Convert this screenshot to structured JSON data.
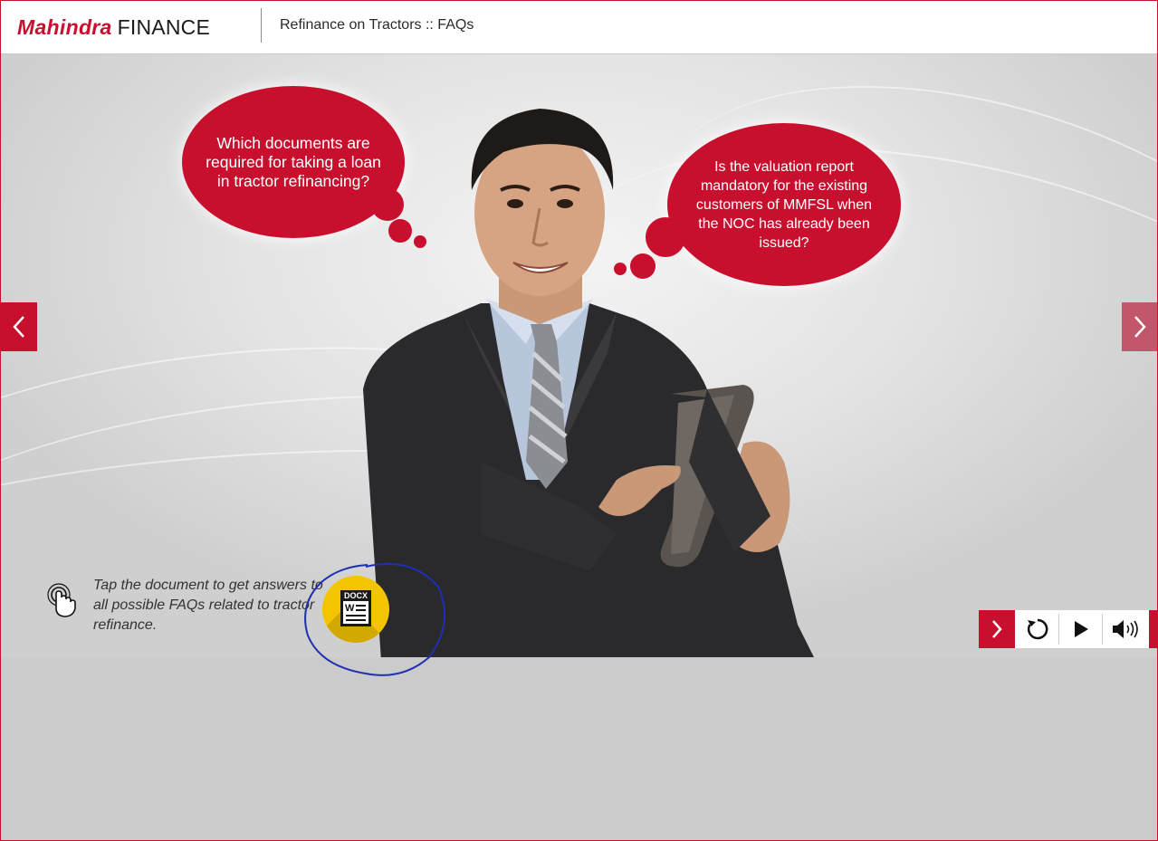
{
  "header": {
    "logo_brand": "Mahindra",
    "logo_finance": "FINANCE",
    "course_title": "Refinance on Tractors :: FAQs"
  },
  "bubbles": {
    "left": "Which documents are required for taking a loan in tractor refinancing?",
    "right": "Is the valuation report mandatory for the existing customers of MMFSL when the NOC has already been issued?"
  },
  "instruction": {
    "text": "Tap the document to get answers to all possible FAQs related to tractor refinance.",
    "icon": "tap-hand-icon"
  },
  "document": {
    "label": "DOCX",
    "letter": "W",
    "icon": "docx-file-icon"
  },
  "navigation": {
    "prev_icon": "chevron-left-icon",
    "next_icon": "chevron-right-icon"
  },
  "controls": {
    "next_icon": "chevron-right-icon",
    "reload_icon": "reload-icon",
    "play_icon": "play-icon",
    "audio_icon": "speaker-icon"
  },
  "colors": {
    "accent": "#c8102e",
    "doc_yellow": "#f2c500",
    "annotation": "#1f2fb3"
  }
}
